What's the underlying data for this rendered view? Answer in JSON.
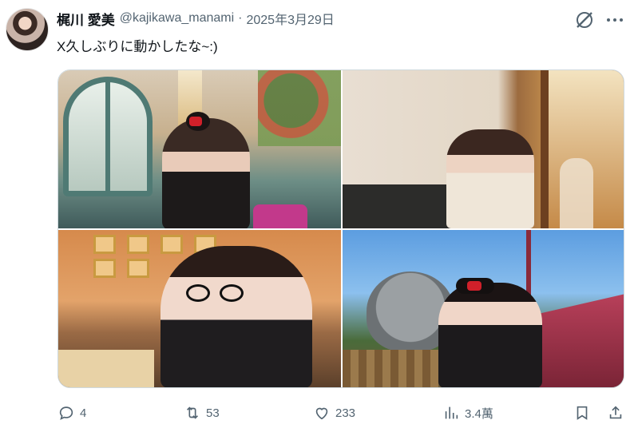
{
  "author": {
    "display_name": "梶川 愛美",
    "handle": "@kajikawa_manami",
    "separator": "·",
    "date": "2025年3月29日"
  },
  "tweet": {
    "text": "X久しぶりに動かしたな~:)"
  },
  "header_icons": {
    "grok": "grok-icon",
    "more": "more-icon"
  },
  "media": [
    {
      "name": "photo-cafe-window"
    },
    {
      "name": "photo-sweater-window"
    },
    {
      "name": "photo-cafe-glasses"
    },
    {
      "name": "photo-pirate-ship"
    }
  ],
  "actions": {
    "reply_count": "4",
    "retweet_count": "53",
    "like_count": "233",
    "views_count": "3.4萬"
  }
}
